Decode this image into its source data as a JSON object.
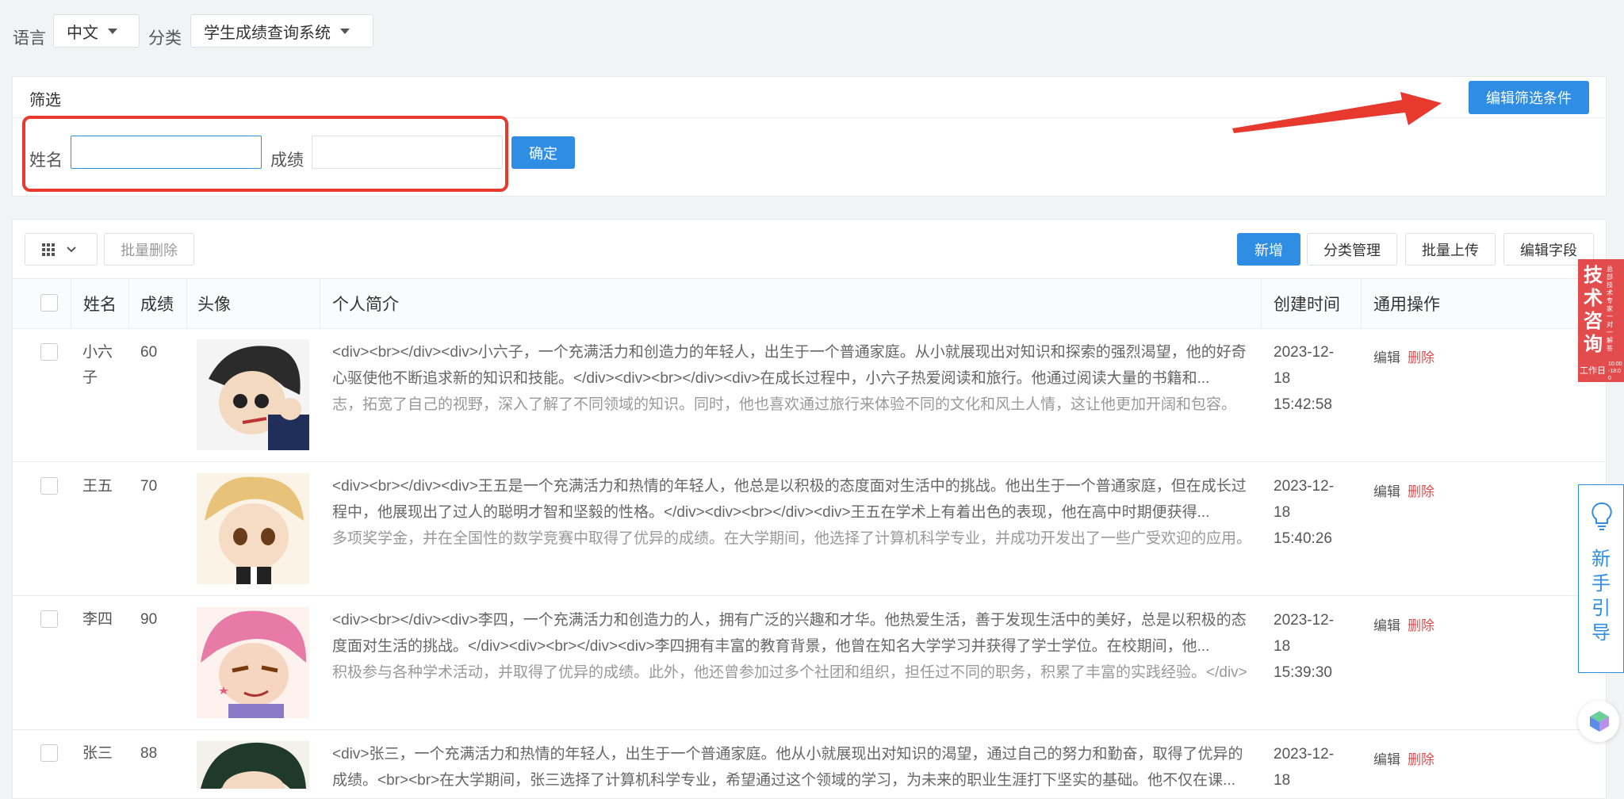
{
  "toolbar": {
    "language_label": "语言",
    "language_value": "中文",
    "category_label": "分类",
    "category_value": "学生成绩查询系统"
  },
  "filter": {
    "title": "筛选",
    "edit_button": "编辑筛选条件",
    "name_label": "姓名",
    "score_label": "成绩",
    "name_value": "",
    "score_value": "",
    "confirm_button": "确定"
  },
  "actions": {
    "batch_delete": "批量删除",
    "add": "新增",
    "category_manage": "分类管理",
    "batch_upload": "批量上传",
    "edit_fields": "编辑字段"
  },
  "table": {
    "headers": [
      "姓名",
      "成绩",
      "头像",
      "个人简介",
      "创建时间",
      "通用操作"
    ],
    "edit_label": "编辑",
    "delete_label": "删除",
    "rows": [
      {
        "name": "小六子",
        "score": "60",
        "bio": "<div><br></div><div>小六子，一个充满活力和创造力的年轻人，出生于一个普通家庭。从小就展现出对知识和探索的强烈渴望，他的好奇心驱使他不断追求新的知识和技能。</div><div><br></div><div>在成长过程中，小六子热爱阅读和旅行。他通过阅读大量的书籍和...",
        "bio_partial": "志，拓宽了自己的视野，深入了解了不同领域的知识。同时，他也喜欢通过旅行来体验不同的文化和风土人情，这让他更加开阔和包容。",
        "date_line1": "2023-12-",
        "date_line2": "18",
        "date_line3": "15:42:58",
        "avatar_color": "#3a3a3a"
      },
      {
        "name": "王五",
        "score": "70",
        "bio": "<div><br></div><div>王五是一个充满活力和热情的年轻人，他总是以积极的态度面对生活中的挑战。他出生于一个普通家庭，但在成长过程中，他展现出了过人的聪明才智和坚毅的性格。</div><div><br></div><div>王五在学术上有着出色的表现，他在高中时期便获得...",
        "bio_partial": "多项奖学金，并在全国性的数学竞赛中取得了优异的成绩。在大学期间，他选择了计算机科学专业，并成功开发出了一些广受欢迎的应用。",
        "date_line1": "2023-12-",
        "date_line2": "18",
        "date_line3": "15:40:26",
        "avatar_color": "#e9c27a"
      },
      {
        "name": "李四",
        "score": "90",
        "bio": "<div><br></div><div>李四，一个充满活力和创造力的人，拥有广泛的兴趣和才华。他热爱生活，善于发现生活中的美好，总是以积极的态度面对生活的挑战。</div><div><br></div><div>李四拥有丰富的教育背景，他曾在知名大学学习并获得了学士学位。在校期间，他...",
        "bio_partial": "积极参与各种学术活动，并取得了优异的成绩。此外，他还曾参加过多个社团和组织，担任过不同的职务，积累了丰富的实践经验。</div>",
        "date_line1": "2023-12-",
        "date_line2": "18",
        "date_line3": "15:39:30",
        "avatar_color": "#e87aa8"
      },
      {
        "name": "张三",
        "score": "88",
        "bio": "<div>张三，一个充满活力和热情的年轻人，出生于一个普通家庭。他从小就展现出对知识的渴望，通过自己的努力和勤奋，取得了优异的成绩。<br><br>在大学期间，张三选择了计算机科学专业，希望通过这个领域的学习，为未来的职业生涯打下坚实的基础。他不仅在课...",
        "bio_partial": "",
        "date_line1": "2023-12-",
        "date_line2": "18",
        "date_line3": "",
        "avatar_color": "#2f5a3a"
      }
    ]
  },
  "widgets": {
    "tech_badge_main": "技术咨询",
    "tech_badge_side": "总部技术专家一对一解答",
    "tech_badge_foot": "工作日",
    "tech_badge_hours": "10:00-18:00",
    "guide_text": "新手引导"
  },
  "colors": {
    "primary": "#2f8de4",
    "danger": "#e34c4c",
    "annotation_red": "#e8392f"
  }
}
